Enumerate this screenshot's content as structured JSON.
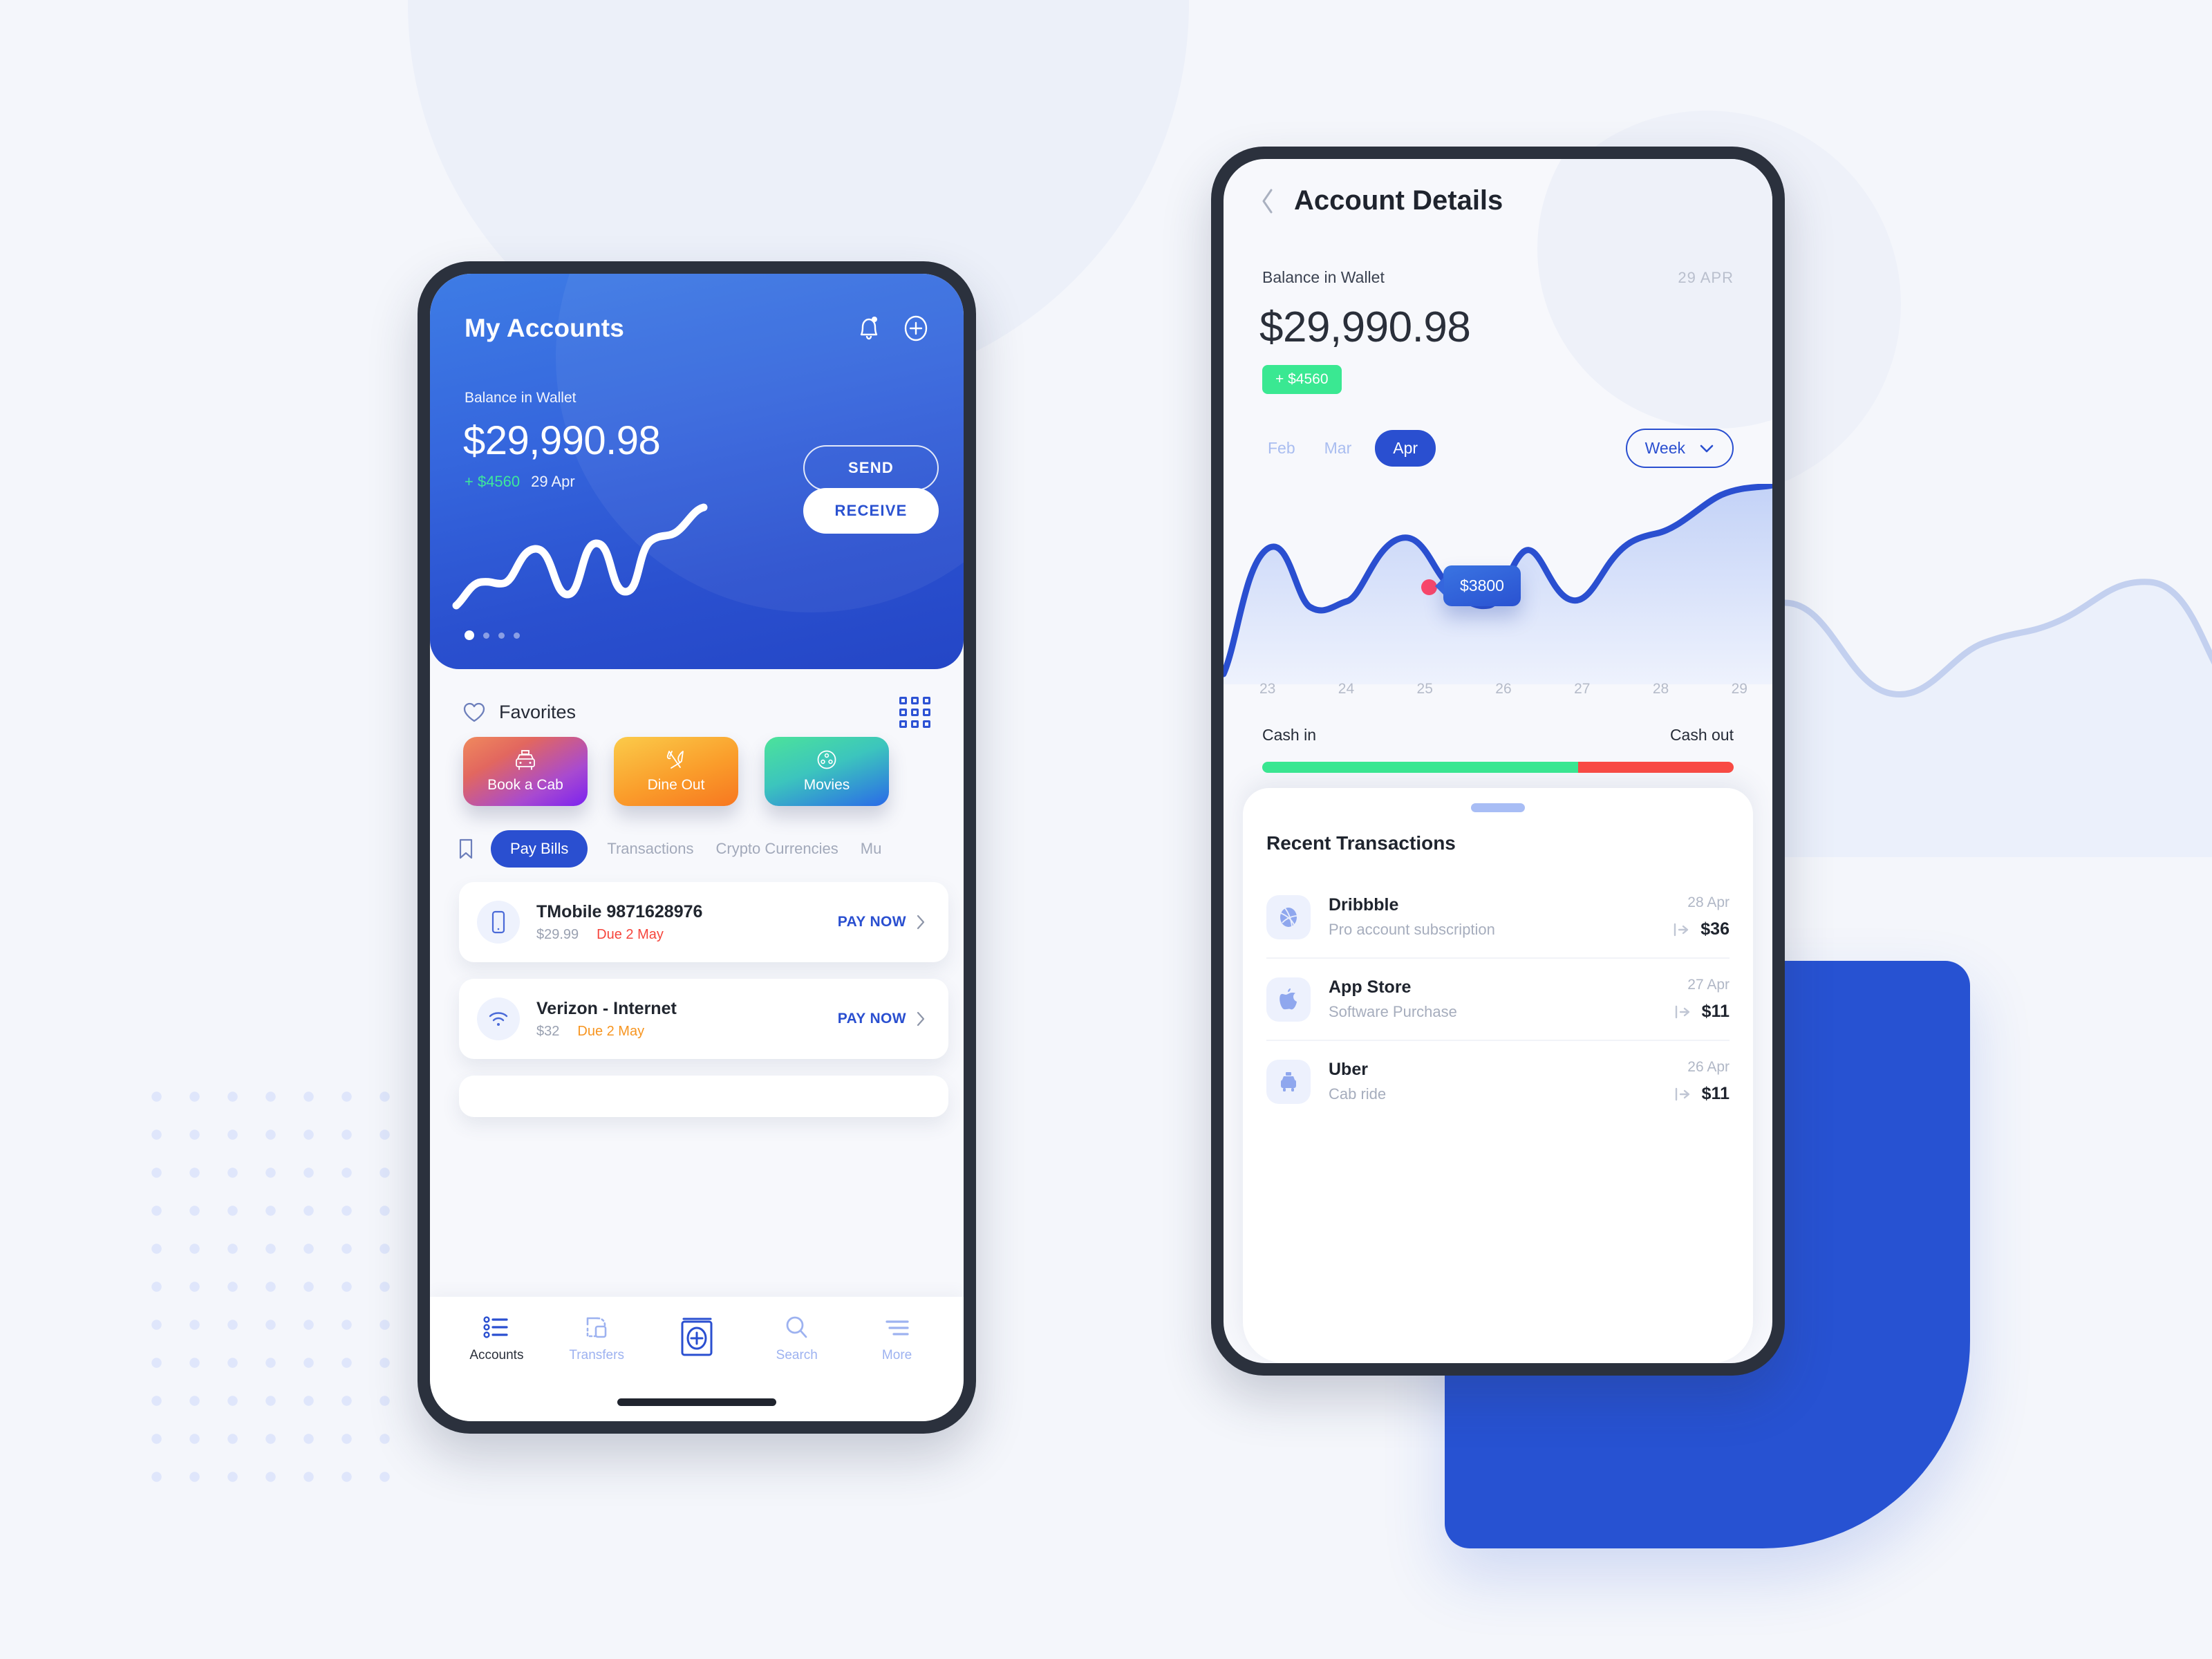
{
  "theme": {
    "page_bg": "#f4f6fb",
    "brand_blue": "#2a4fd0",
    "card_blue_top": "#3e7ce5",
    "card_blue_bottom": "#2446c6",
    "green": "#3ae892",
    "red": "#f6453c",
    "orange": "#f79520",
    "pink_dot": "#f8476b"
  },
  "accounts_screen": {
    "title": "My Accounts",
    "icons": {
      "bell": "bell-icon",
      "add": "plus-circle-icon"
    },
    "balance_label": "Balance in Wallet",
    "balance_amount": "$29,990.98",
    "delta": "+ $4560",
    "delta_date": "29 Apr",
    "send_label": "SEND",
    "receive_label": "RECEIVE",
    "carousel_dots": 4,
    "carousel_active_index": 0,
    "favorites": {
      "title": "Favorites",
      "heart_icon": "heart-icon",
      "grid_icon": "grid-icon",
      "cards": [
        {
          "label": "Book a Cab",
          "icon": "taxi-icon"
        },
        {
          "label": "Dine Out",
          "icon": "cutlery-icon"
        },
        {
          "label": "Movies",
          "icon": "film-reel-icon"
        }
      ]
    },
    "tabs": [
      {
        "label": "Pay Bills",
        "active": true
      },
      {
        "label": "Transactions",
        "active": false
      },
      {
        "label": "Crypto Currencies",
        "active": false
      },
      {
        "label": "Mu",
        "active": false
      }
    ],
    "bills": [
      {
        "name": "TMobile 9871628976",
        "amount": "$29.99",
        "due": "Due 2 May",
        "due_color": "red",
        "action": "PAY NOW",
        "icon": "smartphone-icon"
      },
      {
        "name": "Verizon - Internet",
        "amount": "$32",
        "due": "Due 2 May",
        "due_color": "orange",
        "action": "PAY NOW",
        "icon": "wifi-icon"
      }
    ],
    "bottom_nav": [
      {
        "label": "Accounts",
        "icon": "list-icon",
        "active": true
      },
      {
        "label": "Transfers",
        "icon": "transfer-icon",
        "active": false
      },
      {
        "label": "",
        "icon": "book-plus-icon",
        "active": false
      },
      {
        "label": "Search",
        "icon": "search-icon",
        "active": false
      },
      {
        "label": "More",
        "icon": "menu-icon",
        "active": false
      }
    ]
  },
  "details_screen": {
    "back_icon": "chevron-left-icon",
    "title": "Account Details",
    "balance_label": "Balance in Wallet",
    "balance_date": "29 APR",
    "balance_amount": "$29,990.98",
    "badge": "+ $4560",
    "months": [
      {
        "label": "Feb",
        "active": false
      },
      {
        "label": "Mar",
        "active": false
      },
      {
        "label": "Apr",
        "active": true
      }
    ],
    "range_selector": {
      "label": "Week",
      "icon": "chevron-down-icon"
    },
    "tooltip_value": "$3800",
    "cash_in_label": "Cash in",
    "cash_out_label": "Cash out",
    "cash_in_percent": 67,
    "cash_out_percent": 33,
    "sheet_title": "Recent Transactions",
    "transactions": [
      {
        "name": "Dribbble",
        "description": "Pro account subscription",
        "date": "28 Apr",
        "amount": "$36",
        "icon": "dribbble-icon"
      },
      {
        "name": "App Store",
        "description": "Software Purchase",
        "date": "27 Apr",
        "amount": "$11",
        "icon": "apple-icon"
      },
      {
        "name": "Uber",
        "description": "Cab ride",
        "date": "26 Apr",
        "amount": "$11",
        "icon": "taxi-icon"
      }
    ]
  },
  "chart_data": {
    "type": "area",
    "title": "Account balance over week",
    "x": [
      23,
      24,
      25,
      26,
      27,
      28,
      29
    ],
    "xlabel": "",
    "ylabel": "",
    "values": [
      3200,
      4400,
      3600,
      3800,
      4700,
      3400,
      5100
    ],
    "tick_labels": [
      "23",
      "24",
      "25",
      "26",
      "27",
      "28",
      "29"
    ],
    "highlight": {
      "x": 25,
      "value": 3800,
      "label": "$3800"
    },
    "grid": false,
    "legend": "none",
    "line_color": "#2a4fd0",
    "fill_gradient": [
      "#c3d2f7",
      "#eef2fd"
    ]
  },
  "sparkline_data": {
    "type": "line",
    "values": [
      8,
      30,
      36,
      34,
      58,
      28,
      20,
      64,
      30,
      24,
      62,
      70,
      88,
      95
    ],
    "line_color": "#ffffff",
    "grid": false
  }
}
